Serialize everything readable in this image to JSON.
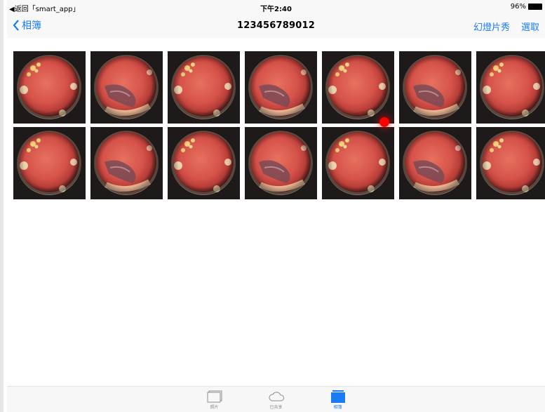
{
  "status": {
    "back_app": "◀返回「smart_app」",
    "time": "下午2:40",
    "battery": "96%"
  },
  "nav": {
    "back_label": "相簿",
    "title": "123456789012",
    "slideshow": "幻燈片秀",
    "select": "選取"
  },
  "photos": [
    "a",
    "b",
    "a",
    "b",
    "a",
    "b",
    "a",
    "a",
    "b",
    "a",
    "b",
    "a",
    "b",
    "a"
  ],
  "tabs": [
    {
      "label": "照片",
      "icon": "photos-icon"
    },
    {
      "label": "已共享",
      "icon": "cloud-icon"
    },
    {
      "label": "相簿",
      "icon": "albums-icon",
      "active": true
    }
  ],
  "colors": {
    "accent": "#1a7cf5",
    "marker": "#ff0000"
  }
}
